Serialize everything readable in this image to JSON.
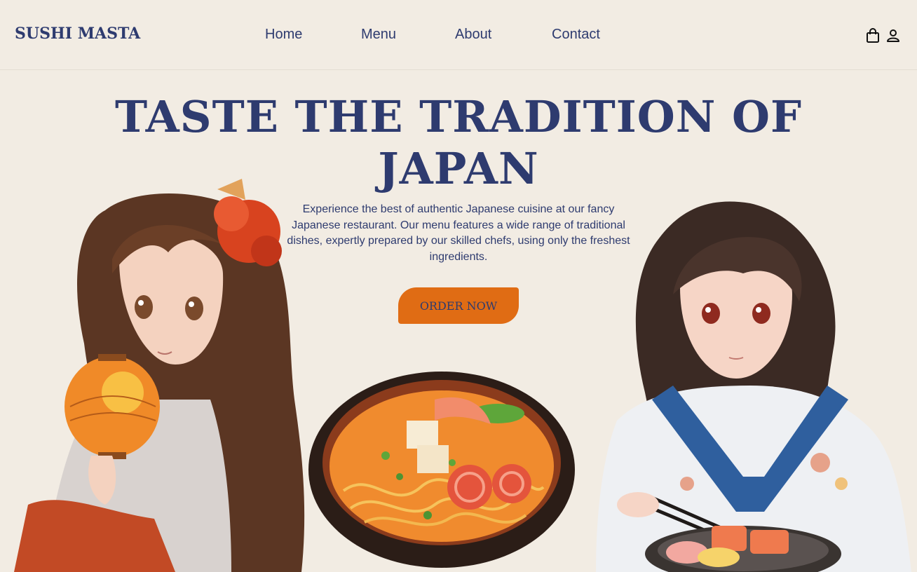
{
  "header": {
    "logo": "SUSHI MASTA",
    "nav": {
      "home": "Home",
      "menu": "Menu",
      "about": "About",
      "contact": "Contact"
    },
    "icons": [
      "shopping-bag-icon",
      "user-icon"
    ]
  },
  "hero": {
    "title_line1": "TASTE THE TRADITION OF",
    "title_line2": "JAPAN",
    "description": "Experience the best of authentic Japanese cuisine at our fancy Japanese restaurant. Our menu features a wide range of traditional dishes, expertly prepared by our skilled chefs, using only the freshest ingredients.",
    "cta_label": "ORDER NOW"
  },
  "colors": {
    "background": "#f2ece3",
    "primary_text": "#2e3b6f",
    "cta": "#e06c14"
  }
}
